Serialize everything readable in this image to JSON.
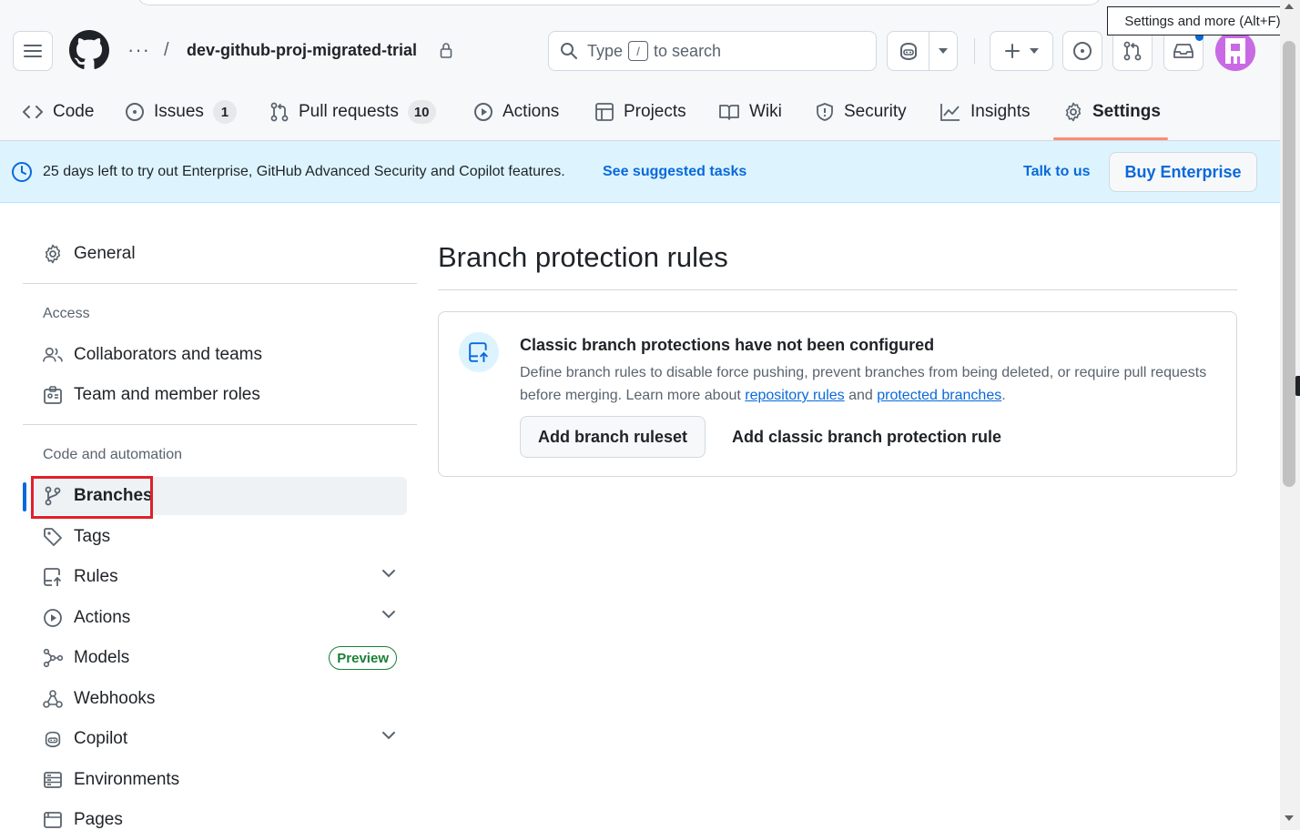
{
  "header": {
    "repo_name": "dev-github-proj-migrated-trial",
    "breadcrumb_more": "···",
    "breadcrumb_sep": "/",
    "search": {
      "prefix": "Type",
      "key": "/",
      "suffix": "to search"
    },
    "tooltip": "Settings and more (Alt+F)",
    "icons": [
      "hamburger-icon",
      "github-logo",
      "lock-icon",
      "search-icon",
      "copilot-icon",
      "plus-icon",
      "issues-icon",
      "pull-request-icon",
      "inbox-icon"
    ]
  },
  "repo_nav": {
    "items": [
      {
        "label": "Code",
        "icon": "code-icon"
      },
      {
        "label": "Issues",
        "icon": "issue-icon",
        "count": "1"
      },
      {
        "label": "Pull requests",
        "icon": "pull-request-icon",
        "count": "10"
      },
      {
        "label": "Actions",
        "icon": "play-icon"
      },
      {
        "label": "Projects",
        "icon": "table-icon"
      },
      {
        "label": "Wiki",
        "icon": "book-icon"
      },
      {
        "label": "Security",
        "icon": "shield-icon"
      },
      {
        "label": "Insights",
        "icon": "graph-icon"
      },
      {
        "label": "Settings",
        "icon": "gear-icon",
        "active": true
      }
    ]
  },
  "banner": {
    "message": "25 days left to try out Enterprise, GitHub Advanced Security and Copilot features.",
    "link": "See suggested tasks",
    "talk": "Talk to us",
    "buy": "Buy Enterprise"
  },
  "sidebar": {
    "general": "General",
    "access_heading": "Access",
    "access": [
      "Collaborators and teams",
      "Team and member roles"
    ],
    "code_heading": "Code and automation",
    "code": [
      "Branches",
      "Tags",
      "Rules",
      "Actions",
      "Models",
      "Webhooks",
      "Copilot",
      "Environments",
      "Pages"
    ],
    "preview_badge": "Preview",
    "active": "Branches"
  },
  "main": {
    "title": "Branch protection rules",
    "blank": {
      "heading": "Classic branch protections have not been configured",
      "text1": "Define branch rules to disable force pushing, prevent branches from being deleted, or require pull requests before merging. Learn more about ",
      "link1": "repository rules",
      "and": " and ",
      "link2": "protected branches",
      "end": ".",
      "add_ruleset": "Add branch ruleset",
      "add_classic": "Add classic branch protection rule"
    }
  },
  "colors": {
    "accent": "#0969da",
    "underline": "#fd8c73",
    "banner_bg": "#ddf4ff",
    "highlight": "#e0202a",
    "preview": "#1a7f37"
  }
}
